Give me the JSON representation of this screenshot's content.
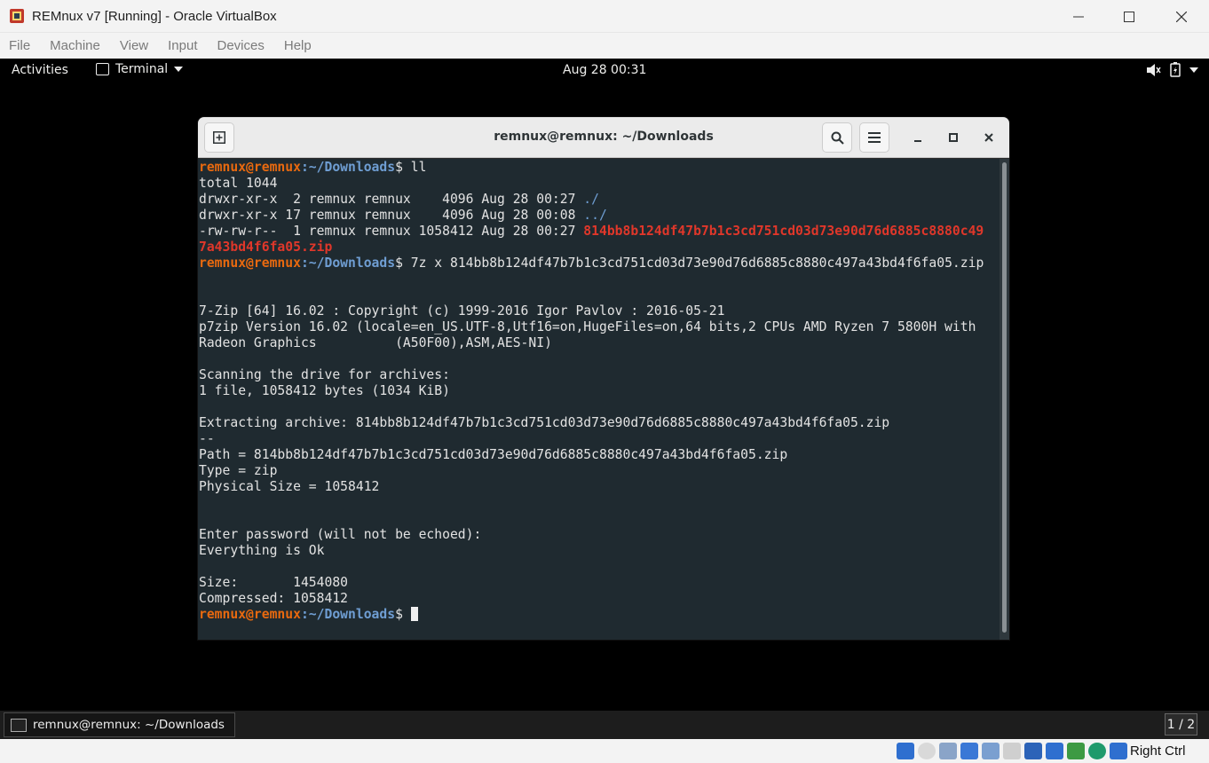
{
  "vbox": {
    "title": "REMnux v7 [Running] - Oracle VirtualBox",
    "menu": [
      "File",
      "Machine",
      "View",
      "Input",
      "Devices",
      "Help"
    ],
    "host_key": "Right Ctrl"
  },
  "gnome": {
    "activities": "Activities",
    "app_menu": "Terminal",
    "clock": "Aug 28  00:31",
    "workspace": "1 / 2"
  },
  "terminal": {
    "title": "remnux@remnux: ~/Downloads",
    "prompt_user": "remnux@remnux",
    "prompt_path": ":~/Downloads",
    "prompt_symbol": "$ ",
    "cmd1": "ll",
    "listing": {
      "total": "total 1044",
      "row1_prefix": "drwxr-xr-x  2 remnux remnux    4096 Aug 28 00:27 ",
      "row1_name": "./",
      "row2_prefix": "drwxr-xr-x 17 remnux remnux    4096 Aug 28 00:08 ",
      "row2_name": "../",
      "row3_prefix": "-rw-rw-r--  1 remnux remnux 1058412 Aug 28 00:27 ",
      "row3_name_a": "814bb8b124df47b7b1c3cd751cd03d73e90d76d6885c8880c49",
      "row3_name_b": "7a43bd4f6fa05.zip"
    },
    "cmd2": "7z x 814bb8b124df47b7b1c3cd751cd03d73e90d76d6885c8880c497a43bd4f6fa05.zip",
    "output": [
      "",
      "",
      "7-Zip [64] 16.02 : Copyright (c) 1999-2016 Igor Pavlov : 2016-05-21",
      "p7zip Version 16.02 (locale=en_US.UTF-8,Utf16=on,HugeFiles=on,64 bits,2 CPUs AMD Ryzen 7 5800H with",
      "Radeon Graphics          (A50F00),ASM,AES-NI)",
      "",
      "Scanning the drive for archives:",
      "1 file, 1058412 bytes (1034 KiB)",
      "",
      "Extracting archive: 814bb8b124df47b7b1c3cd751cd03d73e90d76d6885c8880c497a43bd4f6fa05.zip",
      "--",
      "Path = 814bb8b124df47b7b1c3cd751cd03d73e90d76d6885c8880c497a43bd4f6fa05.zip",
      "Type = zip",
      "Physical Size = 1058412",
      "",
      "",
      "Enter password (will not be echoed):",
      "Everything is Ok",
      "",
      "Size:       1454080",
      "Compressed: 1058412"
    ]
  },
  "taskbar": {
    "item": "remnux@remnux: ~/Downloads"
  },
  "icons": [
    "virtualbox-logo-icon",
    "new-tab-icon",
    "search-icon",
    "hamburger-menu-icon",
    "minimize-icon",
    "maximize-icon",
    "close-icon",
    "volume-muted-icon",
    "battery-icon",
    "chevron-down-icon",
    "terminal-icon"
  ],
  "colors": {
    "prompt_user": "#e8690f",
    "prompt_path": "#6f9ed3",
    "zip_file": "#e0372a",
    "terminal_bg": "#1f2a30"
  }
}
